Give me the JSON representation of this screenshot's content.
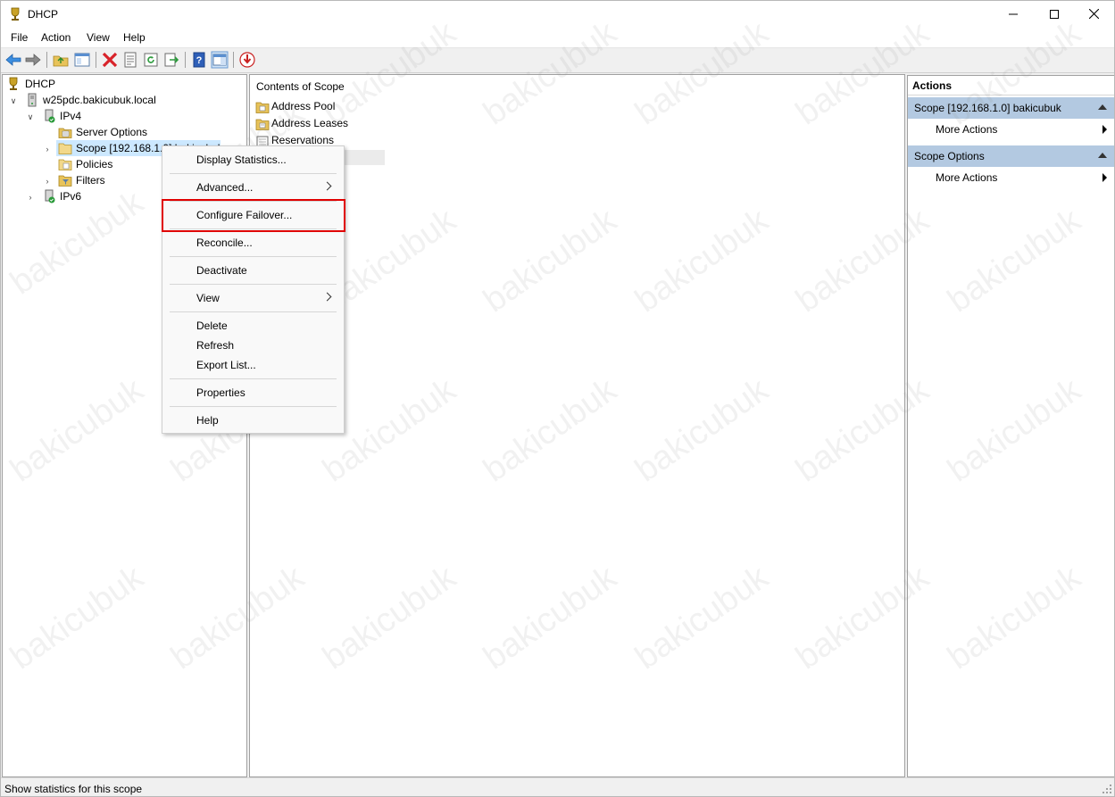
{
  "window": {
    "title": "DHCP"
  },
  "menubar": {
    "items": [
      "File",
      "Action",
      "View",
      "Help"
    ]
  },
  "tree": {
    "root": "DHCP",
    "server": "w25pdc.bakicubuk.local",
    "ipv4": "IPv4",
    "server_options": "Server Options",
    "scope": "Scope [192.168.1.0] bakicubuk",
    "policies": "Policies",
    "filters": "Filters",
    "ipv6": "IPv6"
  },
  "content": {
    "header": "Contents of Scope",
    "items": [
      "Address Pool",
      "Address Leases",
      "Reservations"
    ]
  },
  "context_menu": {
    "items": [
      "Display Statistics...",
      "Advanced...",
      "Configure Failover...",
      "Reconcile...",
      "Deactivate",
      "View",
      "Delete",
      "Refresh",
      "Export List...",
      "Properties",
      "Help"
    ]
  },
  "actions": {
    "header": "Actions",
    "group1": "Scope [192.168.1.0] bakicubuk",
    "group1_item": "More Actions",
    "group2": "Scope Options",
    "group2_item": "More Actions"
  },
  "status": {
    "text": "Show statistics for this scope"
  },
  "watermark": "bakicubuk",
  "colors": {
    "selection": "#cce8ff",
    "action_group": "#b3c9e1",
    "highlight": "#e00000"
  }
}
